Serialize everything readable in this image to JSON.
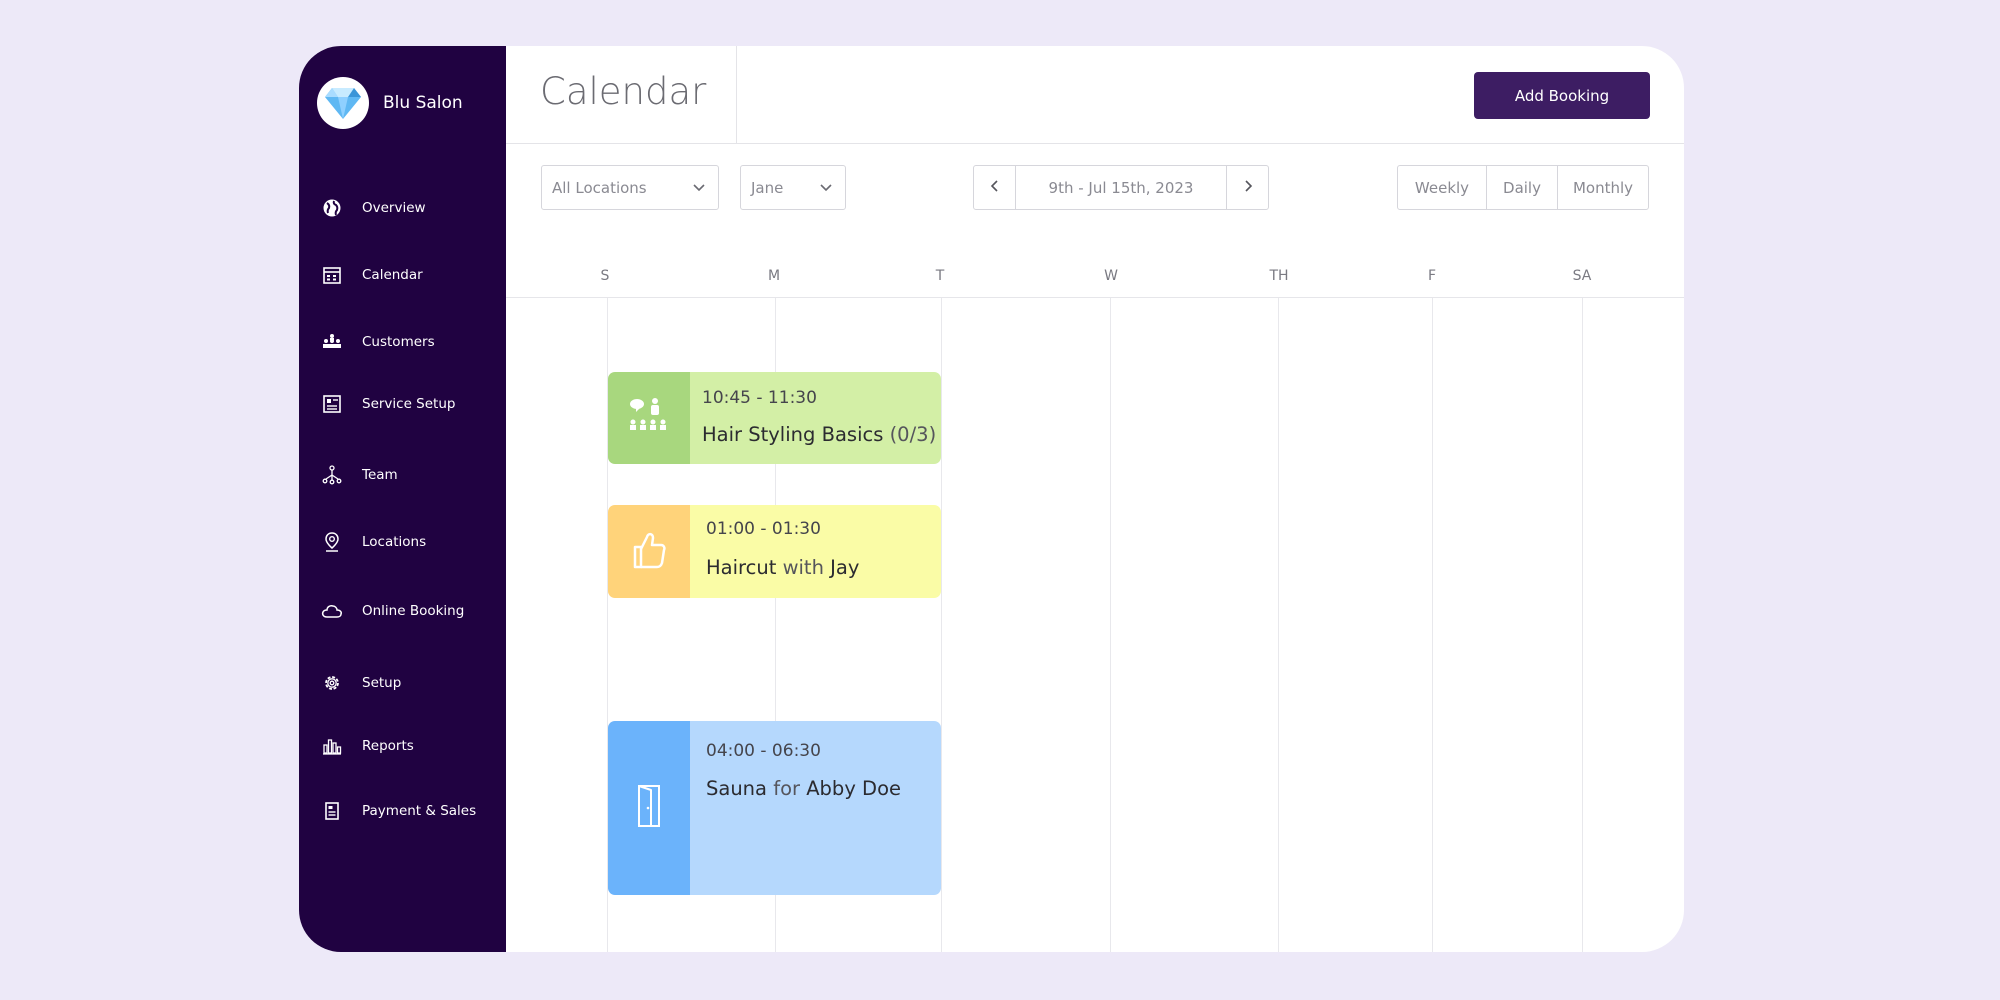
{
  "brand": {
    "name": "Blu Salon"
  },
  "sidebar": {
    "items": [
      {
        "label": "Overview",
        "icon": "globe-icon"
      },
      {
        "label": "Calendar",
        "icon": "calendar-icon"
      },
      {
        "label": "Customers",
        "icon": "customers-icon"
      },
      {
        "label": "Service Setup",
        "icon": "service-setup-icon"
      },
      {
        "label": "Team",
        "icon": "team-icon"
      },
      {
        "label": "Locations",
        "icon": "location-pin-icon"
      },
      {
        "label": "Online Booking",
        "icon": "cloud-icon"
      },
      {
        "label": "Setup",
        "icon": "gear-icon"
      },
      {
        "label": "Reports",
        "icon": "bar-chart-icon"
      },
      {
        "label": "Payment & Sales",
        "icon": "receipt-icon"
      }
    ]
  },
  "header": {
    "title": "Calendar",
    "add_booking_label": "Add Booking"
  },
  "toolbar": {
    "location_select": "All Locations",
    "staff_select": "Jane",
    "date_range": "9th - Jul 15th, 2023",
    "views": [
      "Weekly",
      "Daily",
      "Monthly"
    ]
  },
  "calendar": {
    "days": [
      "S",
      "M",
      "T",
      "W",
      "TH",
      "F",
      "SA"
    ]
  },
  "events": [
    {
      "time": "10:45 - 11:30",
      "title": "Hair Styling Basics",
      "suffix": "(0/3)",
      "icon": "class-group-icon",
      "color": "#d3efa6",
      "icon_bg": "#a8d77e"
    },
    {
      "time": "01:00 - 01:30",
      "title": "Haircut",
      "connector": "with",
      "person": "Jay",
      "icon": "thumbs-up-icon",
      "color": "#fafca6",
      "icon_bg": "#ffd37a"
    },
    {
      "time": "04:00 - 06:30",
      "title": "Sauna",
      "connector": "for",
      "person": "Abby Doe",
      "icon": "door-icon",
      "color": "#b5d8fd",
      "icon_bg": "#6bb3fb"
    }
  ],
  "colors": {
    "sidebar": "#200241",
    "primary_button": "#3d1d63",
    "background": "#ede9f8"
  }
}
